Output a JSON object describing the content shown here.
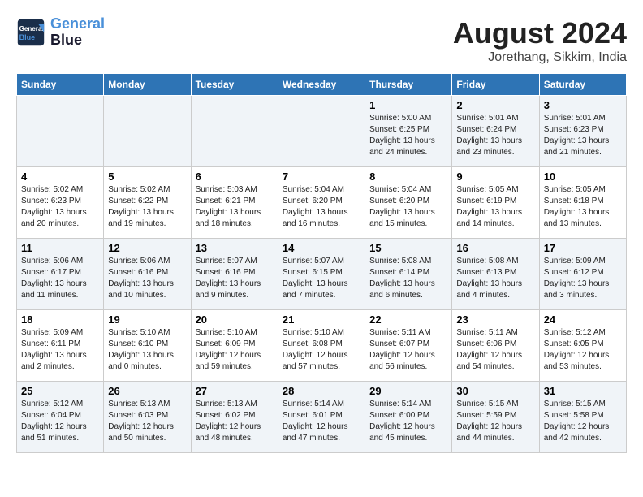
{
  "header": {
    "logo_line1": "General",
    "logo_line2": "Blue",
    "month_title": "August 2024",
    "location": "Jorethang, Sikkim, India"
  },
  "weekdays": [
    "Sunday",
    "Monday",
    "Tuesday",
    "Wednesday",
    "Thursday",
    "Friday",
    "Saturday"
  ],
  "weeks": [
    [
      {
        "day": "",
        "info": ""
      },
      {
        "day": "",
        "info": ""
      },
      {
        "day": "",
        "info": ""
      },
      {
        "day": "",
        "info": ""
      },
      {
        "day": "1",
        "info": "Sunrise: 5:00 AM\nSunset: 6:25 PM\nDaylight: 13 hours\nand 24 minutes."
      },
      {
        "day": "2",
        "info": "Sunrise: 5:01 AM\nSunset: 6:24 PM\nDaylight: 13 hours\nand 23 minutes."
      },
      {
        "day": "3",
        "info": "Sunrise: 5:01 AM\nSunset: 6:23 PM\nDaylight: 13 hours\nand 21 minutes."
      }
    ],
    [
      {
        "day": "4",
        "info": "Sunrise: 5:02 AM\nSunset: 6:23 PM\nDaylight: 13 hours\nand 20 minutes."
      },
      {
        "day": "5",
        "info": "Sunrise: 5:02 AM\nSunset: 6:22 PM\nDaylight: 13 hours\nand 19 minutes."
      },
      {
        "day": "6",
        "info": "Sunrise: 5:03 AM\nSunset: 6:21 PM\nDaylight: 13 hours\nand 18 minutes."
      },
      {
        "day": "7",
        "info": "Sunrise: 5:04 AM\nSunset: 6:20 PM\nDaylight: 13 hours\nand 16 minutes."
      },
      {
        "day": "8",
        "info": "Sunrise: 5:04 AM\nSunset: 6:20 PM\nDaylight: 13 hours\nand 15 minutes."
      },
      {
        "day": "9",
        "info": "Sunrise: 5:05 AM\nSunset: 6:19 PM\nDaylight: 13 hours\nand 14 minutes."
      },
      {
        "day": "10",
        "info": "Sunrise: 5:05 AM\nSunset: 6:18 PM\nDaylight: 13 hours\nand 13 minutes."
      }
    ],
    [
      {
        "day": "11",
        "info": "Sunrise: 5:06 AM\nSunset: 6:17 PM\nDaylight: 13 hours\nand 11 minutes."
      },
      {
        "day": "12",
        "info": "Sunrise: 5:06 AM\nSunset: 6:16 PM\nDaylight: 13 hours\nand 10 minutes."
      },
      {
        "day": "13",
        "info": "Sunrise: 5:07 AM\nSunset: 6:16 PM\nDaylight: 13 hours\nand 9 minutes."
      },
      {
        "day": "14",
        "info": "Sunrise: 5:07 AM\nSunset: 6:15 PM\nDaylight: 13 hours\nand 7 minutes."
      },
      {
        "day": "15",
        "info": "Sunrise: 5:08 AM\nSunset: 6:14 PM\nDaylight: 13 hours\nand 6 minutes."
      },
      {
        "day": "16",
        "info": "Sunrise: 5:08 AM\nSunset: 6:13 PM\nDaylight: 13 hours\nand 4 minutes."
      },
      {
        "day": "17",
        "info": "Sunrise: 5:09 AM\nSunset: 6:12 PM\nDaylight: 13 hours\nand 3 minutes."
      }
    ],
    [
      {
        "day": "18",
        "info": "Sunrise: 5:09 AM\nSunset: 6:11 PM\nDaylight: 13 hours\nand 2 minutes."
      },
      {
        "day": "19",
        "info": "Sunrise: 5:10 AM\nSunset: 6:10 PM\nDaylight: 13 hours\nand 0 minutes."
      },
      {
        "day": "20",
        "info": "Sunrise: 5:10 AM\nSunset: 6:09 PM\nDaylight: 12 hours\nand 59 minutes."
      },
      {
        "day": "21",
        "info": "Sunrise: 5:10 AM\nSunset: 6:08 PM\nDaylight: 12 hours\nand 57 minutes."
      },
      {
        "day": "22",
        "info": "Sunrise: 5:11 AM\nSunset: 6:07 PM\nDaylight: 12 hours\nand 56 minutes."
      },
      {
        "day": "23",
        "info": "Sunrise: 5:11 AM\nSunset: 6:06 PM\nDaylight: 12 hours\nand 54 minutes."
      },
      {
        "day": "24",
        "info": "Sunrise: 5:12 AM\nSunset: 6:05 PM\nDaylight: 12 hours\nand 53 minutes."
      }
    ],
    [
      {
        "day": "25",
        "info": "Sunrise: 5:12 AM\nSunset: 6:04 PM\nDaylight: 12 hours\nand 51 minutes."
      },
      {
        "day": "26",
        "info": "Sunrise: 5:13 AM\nSunset: 6:03 PM\nDaylight: 12 hours\nand 50 minutes."
      },
      {
        "day": "27",
        "info": "Sunrise: 5:13 AM\nSunset: 6:02 PM\nDaylight: 12 hours\nand 48 minutes."
      },
      {
        "day": "28",
        "info": "Sunrise: 5:14 AM\nSunset: 6:01 PM\nDaylight: 12 hours\nand 47 minutes."
      },
      {
        "day": "29",
        "info": "Sunrise: 5:14 AM\nSunset: 6:00 PM\nDaylight: 12 hours\nand 45 minutes."
      },
      {
        "day": "30",
        "info": "Sunrise: 5:15 AM\nSunset: 5:59 PM\nDaylight: 12 hours\nand 44 minutes."
      },
      {
        "day": "31",
        "info": "Sunrise: 5:15 AM\nSunset: 5:58 PM\nDaylight: 12 hours\nand 42 minutes."
      }
    ]
  ]
}
